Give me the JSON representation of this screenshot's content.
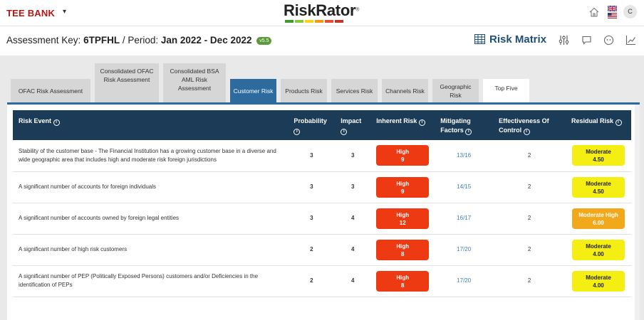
{
  "header": {
    "bank_name": "TEE BANK",
    "bank_caret": "▾",
    "logo_text": "RiskRator",
    "logo_tm": "®",
    "logo_colors": [
      "#3f9a2e",
      "#8cc63f",
      "#f7d416",
      "#f39c12",
      "#e74c3c",
      "#c0392b"
    ],
    "avatar_initial": "C"
  },
  "assessment": {
    "key_label": "Assessment Key:",
    "key_value": "6TPFHL",
    "period_label": "/ Period:",
    "period_value": "Jan 2022 - Dec 2022",
    "version": "v5.5"
  },
  "toolbar": {
    "risk_matrix_label": "Risk Matrix"
  },
  "tabs": [
    {
      "label": "OFAC Risk Assessment"
    },
    {
      "label": "Consolidated OFAC Risk Assessment"
    },
    {
      "label": "Consolidated BSA AML Risk Assessment"
    },
    {
      "label": "Customer Risk"
    },
    {
      "label": "Products Risk"
    },
    {
      "label": "Services Risk"
    },
    {
      "label": "Channels Risk"
    },
    {
      "label": "Geographic Risk"
    },
    {
      "label": "Top Five"
    }
  ],
  "table": {
    "headers": [
      "Risk Event",
      "Probability",
      "Impact",
      "Inherent Risk",
      "Mitigating Factors",
      "Effectiveness Of Control",
      "Residual Risk"
    ],
    "rows": [
      {
        "event": "Stability of the customer base - The Financial Institution has a growing customer base in a diverse and wide geographic area that includes high and moderate risk foreign jurisdictions",
        "probability": "3",
        "impact": "3",
        "inherent_level": "High",
        "inherent_score": "9",
        "mitigating": "13/16",
        "effectiveness": "2",
        "residual_level": "Moderate",
        "residual_score": "4.50"
      },
      {
        "event": "A significant number of accounts for foreign individuals",
        "probability": "3",
        "impact": "3",
        "inherent_level": "High",
        "inherent_score": "9",
        "mitigating": "14/15",
        "effectiveness": "2",
        "residual_level": "Moderate",
        "residual_score": "4.50"
      },
      {
        "event": "A significant number of accounts owned by foreign legal entities",
        "probability": "3",
        "impact": "4",
        "inherent_level": "High",
        "inherent_score": "12",
        "mitigating": "16/17",
        "effectiveness": "2",
        "residual_level": "Moderate High",
        "residual_score": "6.00"
      },
      {
        "event": "A significant number of high risk customers",
        "probability": "2",
        "impact": "4",
        "inherent_level": "High",
        "inherent_score": "8",
        "mitigating": "17/20",
        "effectiveness": "2",
        "residual_level": "Moderate",
        "residual_score": "4.00"
      },
      {
        "event": "A significant number of PEP (Politically Exposed Persons) customers and/or Deficiencies in the identification of PEPs",
        "probability": "2",
        "impact": "4",
        "inherent_level": "High",
        "inherent_score": "8",
        "mitigating": "17/20",
        "effectiveness": "2",
        "residual_level": "Moderate",
        "residual_score": "4.00"
      }
    ]
  }
}
